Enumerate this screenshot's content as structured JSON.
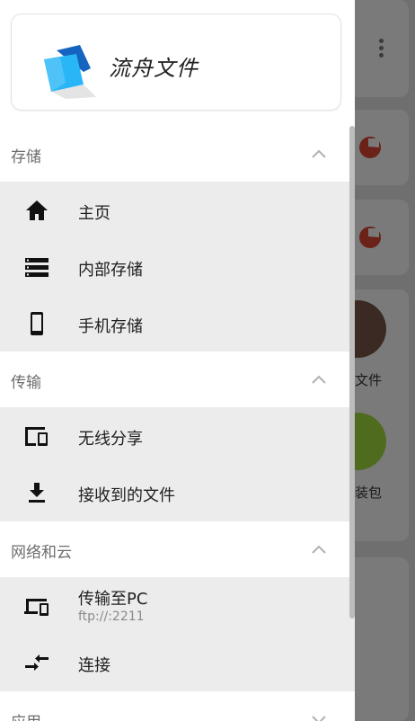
{
  "app": {
    "title": "流舟文件"
  },
  "sections": {
    "storage": {
      "title": "存储"
    },
    "transfer": {
      "title": "传输"
    },
    "network": {
      "title": "网络和云"
    },
    "apps": {
      "title": "应用"
    }
  },
  "items": {
    "home": {
      "label": "主页",
      "icon": "home-icon"
    },
    "internal": {
      "label": "内部存储",
      "icon": "storage-icon"
    },
    "phone": {
      "label": "手机存储",
      "icon": "phone-icon"
    },
    "wireless": {
      "label": "无线分享",
      "icon": "devices-icon"
    },
    "received": {
      "label": "接收到的文件",
      "icon": "download-icon"
    },
    "pc": {
      "label": "传输至PC",
      "sub": "ftp://:2211",
      "icon": "computer-icon"
    },
    "connect": {
      "label": "连接",
      "icon": "swap-icon"
    }
  },
  "background": {
    "label1": "文件",
    "label2": "装包"
  },
  "colors": {
    "accent": "#2196f3",
    "group_bg": "#ececec"
  }
}
